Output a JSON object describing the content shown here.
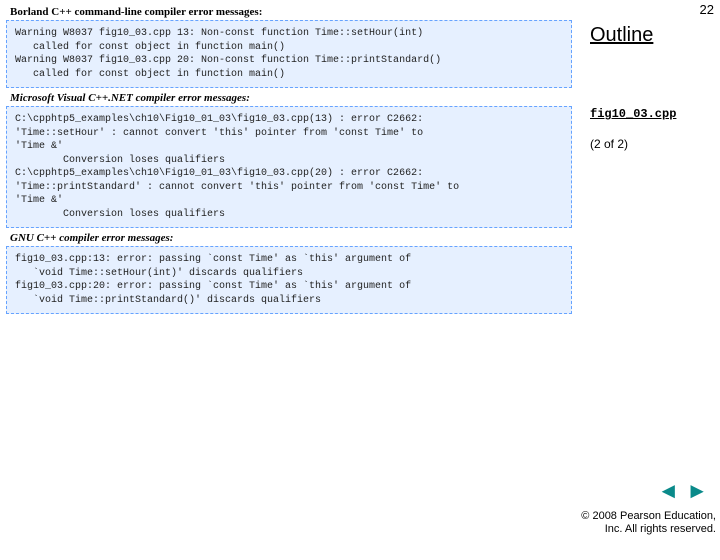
{
  "page_number": "22",
  "outline": {
    "title": "Outline",
    "figfile": "fig10_03.cpp",
    "pager": "(2 of 2)"
  },
  "sections": {
    "borland": {
      "header": "Borland C++ command-line compiler error messages:",
      "code": "Warning W8037 fig10_03.cpp 13: Non-const function Time::setHour(int)\n   called for const object in function main()\nWarning W8037 fig10_03.cpp 20: Non-const function Time::printStandard()\n   called for const object in function main()"
    },
    "msvc": {
      "header": "Microsoft Visual C++.NET compiler error messages:",
      "code": "C:\\cpphtp5_examples\\ch10\\Fig10_01_03\\fig10_03.cpp(13) : error C2662:\n'Time::setHour' : cannot convert 'this' pointer from 'const Time' to\n'Time &'\n        Conversion loses qualifiers\nC:\\cpphtp5_examples\\ch10\\Fig10_01_03\\fig10_03.cpp(20) : error C2662:\n'Time::printStandard' : cannot convert 'this' pointer from 'const Time' to\n'Time &'\n        Conversion loses qualifiers"
    },
    "gnu": {
      "header": "GNU C++ compiler error messages:",
      "code": "fig10_03.cpp:13: error: passing `const Time' as `this' argument of\n   `void Time::setHour(int)' discards qualifiers\nfig10_03.cpp:20: error: passing `const Time' as `this' argument of\n   `void Time::printStandard()' discards qualifiers"
    }
  },
  "footer": {
    "line1": "© 2008 Pearson Education,",
    "line2": "Inc.  All rights reserved."
  },
  "nav": {
    "prev": "◄",
    "next": "►"
  }
}
